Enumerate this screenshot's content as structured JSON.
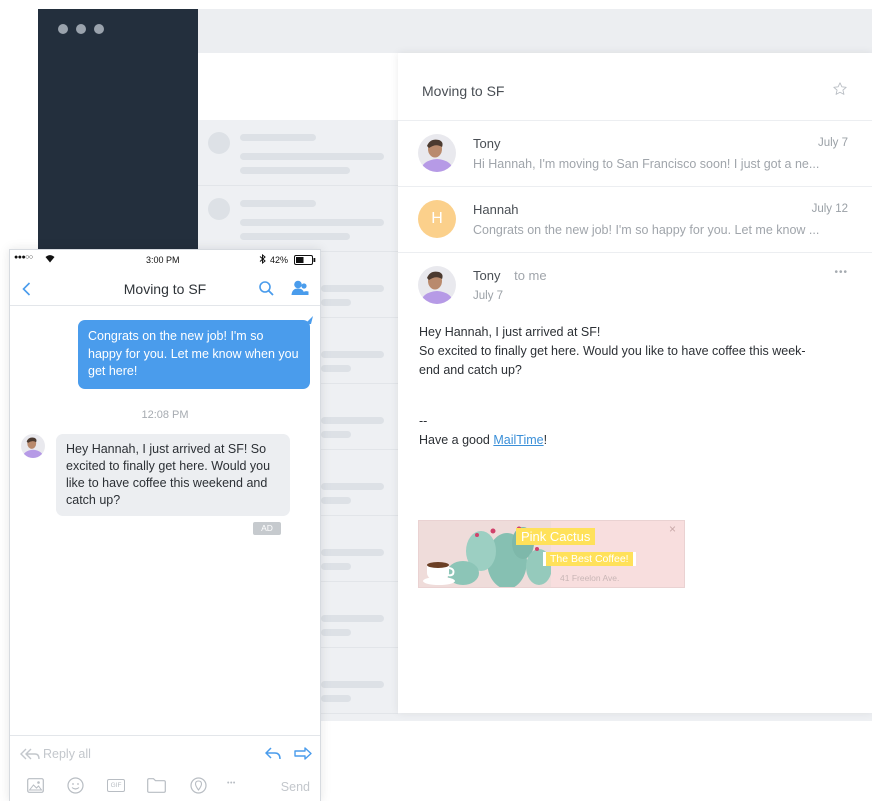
{
  "desktop": {
    "reader": {
      "subject": "Moving to SF",
      "thread": [
        {
          "sender": "Tony",
          "date": "July 7",
          "snippet": "Hi Hannah, I'm moving to San Francisco soon! I just got a ne..."
        },
        {
          "sender": "Hannah",
          "initial": "H",
          "date": "July 12",
          "snippet": "Congrats on the new job! I'm so happy for you. Let me know ..."
        }
      ],
      "open_message": {
        "sender": "Tony",
        "recipient": "to me",
        "date": "July 7",
        "more": "•••",
        "body_lines": [
          "Hey Hannah, I just arrived at SF!",
          "So excited to finally get here. Would you like to have coffee this week-",
          "end and catch up?"
        ],
        "signature_dash": "--",
        "signature_prefix": "Have a good ",
        "signature_link": "MailTime",
        "signature_suffix": "!"
      },
      "ad": {
        "name": "Pink Cactus",
        "tagline": "The Best Coffee!",
        "address": "41 Freelon Ave.",
        "close": "×"
      }
    }
  },
  "phone": {
    "status": {
      "time": "3:00 PM",
      "battery": "42%"
    },
    "title": "Moving to SF",
    "outgoing_message": "Congrats on the new job! I'm so happy for you. Let me know when you get here!",
    "time_label": "12:08 PM",
    "incoming_message": "Hey Hannah, I just arrived at SF! So excited to finally get here. Would you like to have coffee this weekend and catch up?",
    "ad_badge": "AD",
    "reply_all": "Reply all",
    "send": "Send",
    "gif": "GIF",
    "more": "•••"
  },
  "colors": {
    "accent": "#4a9cec",
    "sidebar": "#232f3d",
    "hannah_avatar": "#fbd08b",
    "ad_background": "#f8dede",
    "ad_highlight": "#ffe15a"
  },
  "icons": [
    "star-icon",
    "search-icon",
    "contacts-icon",
    "back-chevron-icon",
    "reply-all-icon",
    "reply-icon",
    "forward-icon",
    "image-icon",
    "emoji-icon",
    "gif-icon",
    "folder-icon",
    "location-icon",
    "more-icon",
    "bluetooth-icon",
    "wifi-icon",
    "battery-icon"
  ]
}
